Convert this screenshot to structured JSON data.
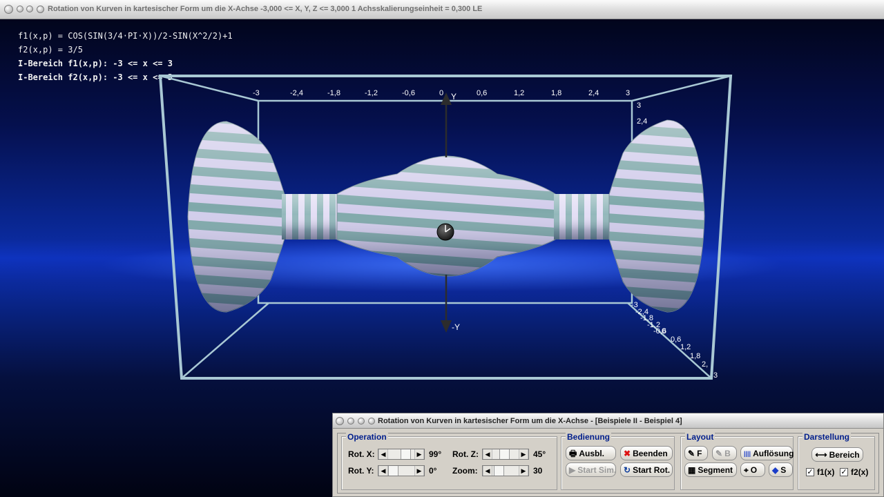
{
  "main_window": {
    "title": "Rotation von Kurven in kartesischer Form um die X-Achse   -3,000 <= X, Y, Z <= 3,000    1 Achsskalierungseinheit = 0,300 LE"
  },
  "info_lines": [
    "f1(x,p) = COS(SIN(3/4·PI·X))/2-SIN(X^2/2)+1",
    "f2(x,p) = 3/5",
    "I-Bereich f1(x,p): -3 <= x <= 3",
    "I-Bereich f2(x,p): -3 <= x <= 3"
  ],
  "axes": {
    "top_ticks": [
      "-3",
      "-2,4",
      "-1,8",
      "-1,2",
      "-0,6",
      "0",
      "0,6",
      "1,2",
      "1,8",
      "2,4",
      "3"
    ],
    "right_ticks": [
      "3",
      "2,4"
    ],
    "diag_ticks": [
      "-3",
      "-2,4",
      "-1,8",
      "-1,2",
      "-0,6",
      "0",
      "0,6",
      "1,2",
      "1,8",
      "2,",
      "3"
    ],
    "y_label": "Y",
    "neg_y_label": "-Y"
  },
  "control_window": {
    "title": "Rotation von Kurven in kartesischer Form um die X-Achse - [Beispiele II - Beispiel 4]",
    "operation": {
      "label": "Operation",
      "rot_x": {
        "label": "Rot. X:",
        "value": "99°"
      },
      "rot_y": {
        "label": "Rot. Y:",
        "value": "0°"
      },
      "rot_z": {
        "label": "Rot. Z:",
        "value": "45°"
      },
      "zoom": {
        "label": "Zoom:",
        "value": "30"
      }
    },
    "bedienung": {
      "label": "Bedienung",
      "ausbl": "Ausbl.",
      "beenden": "Beenden",
      "start_sim": "Start Sim.",
      "start_rot": "Start Rot."
    },
    "layout": {
      "label": "Layout",
      "f": "F",
      "b": "B",
      "aufloesung": "Auflösung",
      "segment": "Segment",
      "o": "O",
      "s": "S"
    },
    "darstellung": {
      "label": "Darstellung",
      "bereich": "Bereich",
      "f1": {
        "label": "f1(x)",
        "checked": true
      },
      "f2": {
        "label": "f2(x)",
        "checked": true
      }
    }
  }
}
